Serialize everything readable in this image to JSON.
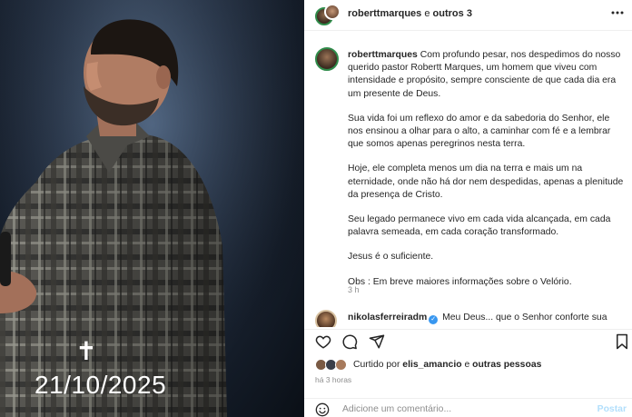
{
  "photo": {
    "cross_symbol": "✝",
    "date": "21/10/2025"
  },
  "header": {
    "username": "roberttmarques",
    "separator": "e",
    "others": "outros 3",
    "more_icon": "more-horizontal-icon"
  },
  "caption": {
    "username": "roberttmarques",
    "paragraphs": [
      "Com profundo pesar, nos despedimos do nosso querido pastor Robertt Marques, um homem que viveu com intensidade e propósito, sempre consciente de que cada dia era um presente de Deus.",
      "Sua vida foi um reflexo do amor e da sabedoria do Senhor, ele nos ensinou a olhar para o alto, a caminhar com fé e a lembrar que somos apenas peregrinos nesta terra.",
      "Hoje, ele completa menos um dia na terra e mais um na eternidade, onde não há dor nem despedidas, apenas a plenitude da presença de Cristo.",
      "Seu legado permanece vivo em cada vida alcançada, em cada palavra semeada, em cada coração transformado.",
      "Jesus é o suficiente.",
      "Obs : Em breve maiores informações sobre o Velório."
    ],
    "time": "3 h"
  },
  "comment": {
    "username": "nikolasferreiradm",
    "verified_icon": "verified-badge-icon",
    "text": "Meu Deus... que o Senhor conforte sua"
  },
  "actions": {
    "icons": [
      "heart-icon",
      "comment-icon",
      "share-icon",
      "bookmark-icon"
    ]
  },
  "likes": {
    "prefix": "Curtido por",
    "user": "elis_amancio",
    "middle": "e",
    "others": "outras pessoas"
  },
  "post_time": "há 3 horas",
  "comment_box": {
    "placeholder": "Adicione um comentário...",
    "post_label": "Postar",
    "emoji_icon": "emoji-icon"
  },
  "colors": {
    "link_blue_disabled": "#b2dffc",
    "verified_blue": "#3897f0",
    "muted_text": "#8e8e8e"
  }
}
